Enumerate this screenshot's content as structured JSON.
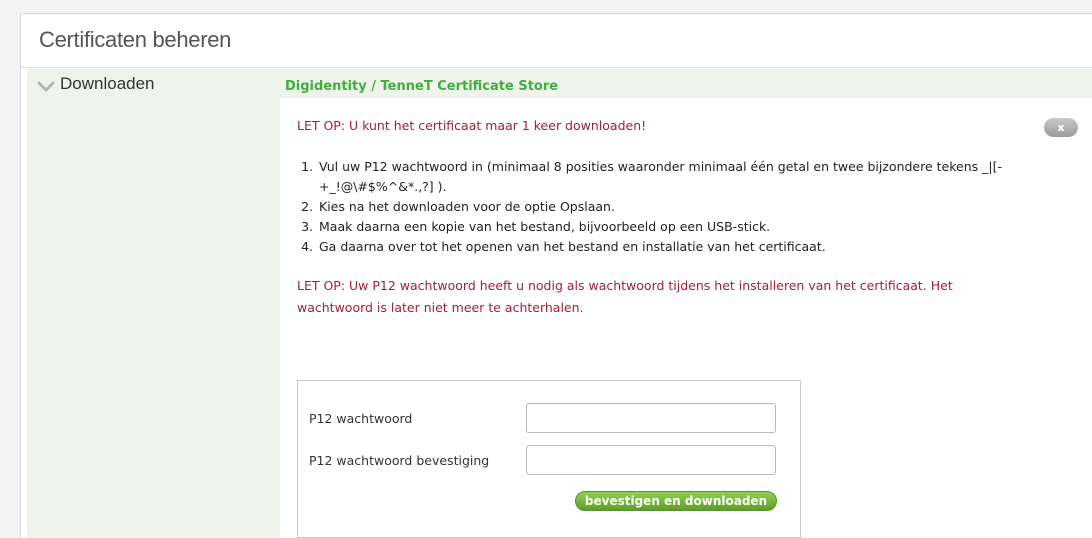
{
  "panel": {
    "title": "Certificaten beheren"
  },
  "sidebar": {
    "items": [
      {
        "label": "Downloaden",
        "icon": "chevron-down-icon"
      }
    ]
  },
  "main": {
    "title": "Digidentity / TenneT Certificate Store",
    "warning_top": "LET OP: U kunt het certificaat maar 1 keer downloaden!",
    "close_label": "x",
    "steps": [
      "Vul uw P12 wachtwoord in (minimaal 8 posities waaronder minimaal één getal en twee bijzondere tekens _|[-+_!@\\#$%^&*.,?] ).",
      "Kies na het downloaden voor de optie Opslaan.",
      "Maak daarna een kopie van het bestand, bijvoorbeeld op een USB-stick.",
      "Ga daarna over tot het openen van het bestand en installatie van het certificaat."
    ],
    "warning_bottom": "LET OP: Uw P12 wachtwoord heeft u nodig als wachtwoord tijdens het installeren van het certificaat. Het wachtwoord is later niet meer te achterhalen."
  },
  "form": {
    "password_label": "P12 wachtwoord",
    "password_value": "",
    "confirm_label": "P12 wachtwoord bevestiging",
    "confirm_value": "",
    "submit_label": "bevestigen en downloaden"
  },
  "colors": {
    "accent_green": "#3fae3f",
    "warning_red": "#a0203a",
    "sidebar_bg": "#eef4ea",
    "button_green": "#6aab30"
  }
}
